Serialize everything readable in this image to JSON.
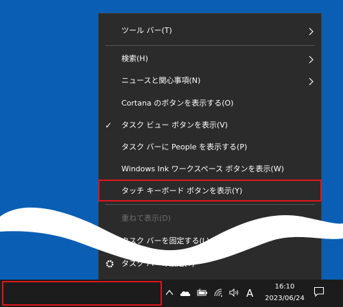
{
  "menu": {
    "items": [
      {
        "label": "ツール バー(T)",
        "has_submenu": true
      },
      {
        "label": "検索(H)",
        "has_submenu": true
      },
      {
        "label": "ニュースと関心事項(N)",
        "has_submenu": true
      },
      {
        "label": "Cortana のボタンを表示する(O)"
      },
      {
        "label": "タスク ビュー ボタンを表示(V)",
        "checked": true
      },
      {
        "label": "タスク バーに People を表示する(P)"
      },
      {
        "label": "Windows Ink ワークスペース ボタンを表示(W)"
      },
      {
        "label": "タッチ キーボード ボタンを表示(Y)",
        "highlighted": true
      },
      {
        "label": "重ねて表示(D)",
        "disabled": true
      },
      {
        "label": "タスク バーを固定する(L)"
      },
      {
        "label": "タスク バーの設定(T)",
        "icon": "gear-icon"
      }
    ],
    "checkmark": "✓"
  },
  "taskbar": {
    "tray_icons": [
      "chevron-up-icon",
      "onedrive-cloud-icon",
      "battery-icon",
      "wifi-icon",
      "volume-icon"
    ],
    "ime_indicator": "A",
    "clock": {
      "time": "16:10",
      "date": "2023/06/24"
    },
    "notification_icon": "notification-icon"
  },
  "colors": {
    "desktop": "#0a5fb4",
    "menu_bg": "#2b2b2b",
    "taskbar_bg": "#1c1c1c",
    "highlight_border": "#e0161c"
  }
}
